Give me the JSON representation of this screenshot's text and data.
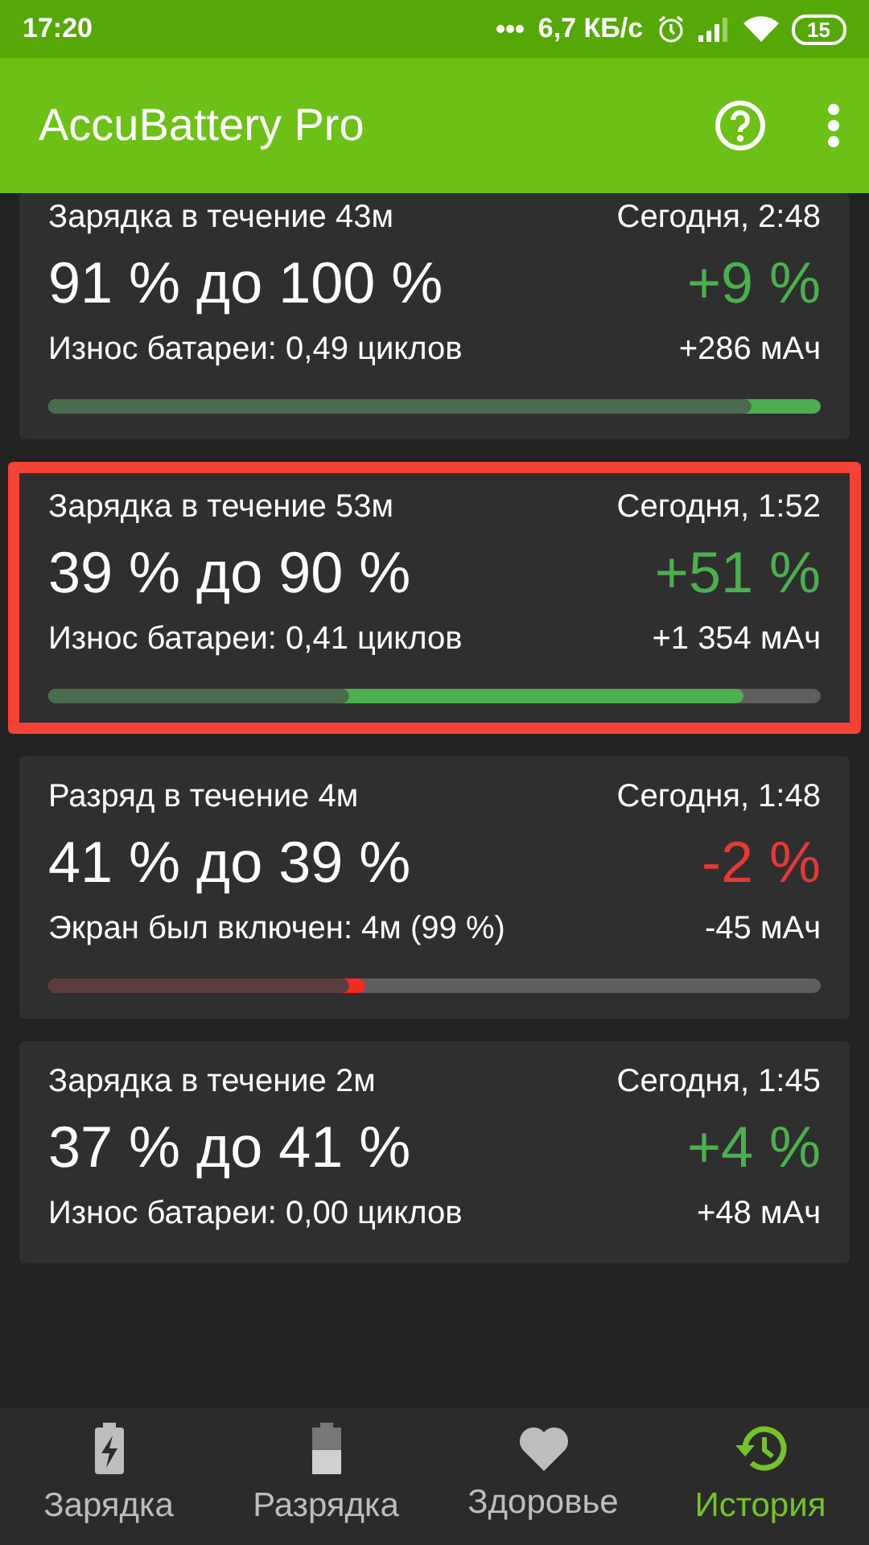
{
  "status_bar": {
    "time": "17:20",
    "speed": "6,7 КБ/с",
    "battery": "15"
  },
  "app_bar": {
    "title": "AccuBattery Pro"
  },
  "sessions": [
    {
      "kind": "charge",
      "highlighted": false,
      "duration": "Зарядка в течение 43м",
      "date": "Сегодня, 2:48",
      "range": "91 % до 100 %",
      "change": "+9 %",
      "detail": "Износ батареи: 0,49 циклов",
      "capacity": "+286 мАч",
      "bar": [
        {
          "kind": "session",
          "level": 1.0
        },
        {
          "kind": "before",
          "level": 0.91
        }
      ]
    },
    {
      "kind": "charge",
      "highlighted": true,
      "duration": "Зарядка в течение 53м",
      "date": "Сегодня, 1:52",
      "range": "39 % до 90 %",
      "change": "+51 %",
      "detail": "Износ батареи: 0,41 циклов",
      "capacity": "+1 354 мАч",
      "bar": [
        {
          "kind": "session",
          "level": 0.9
        },
        {
          "kind": "before",
          "level": 0.39
        }
      ]
    },
    {
      "kind": "discharge",
      "highlighted": false,
      "duration": "Разряд в течение 4м",
      "date": "Сегодня, 1:48",
      "range": "41 % до 39 %",
      "change": "-2 %",
      "detail": "Экран был включен: 4м (99 %)",
      "capacity": "-45 мАч",
      "bar": [
        {
          "kind": "session",
          "level": 0.41
        },
        {
          "kind": "before",
          "level": 0.39
        }
      ]
    },
    {
      "kind": "charge",
      "highlighted": false,
      "duration": "Зарядка в течение 2м",
      "date": "Сегодня, 1:45",
      "range": "37 % до 41 %",
      "change": "+4 %",
      "detail": "Износ батареи: 0,00 циклов",
      "capacity": "+48 мАч"
    }
  ],
  "bottom_nav": [
    {
      "kind": "charging",
      "label": "Зарядка",
      "selected": false
    },
    {
      "kind": "discharging",
      "label": "Разрядка",
      "selected": false
    },
    {
      "kind": "health",
      "label": "Здоровье",
      "selected": false
    },
    {
      "kind": "history",
      "label": "История",
      "selected": true
    }
  ]
}
